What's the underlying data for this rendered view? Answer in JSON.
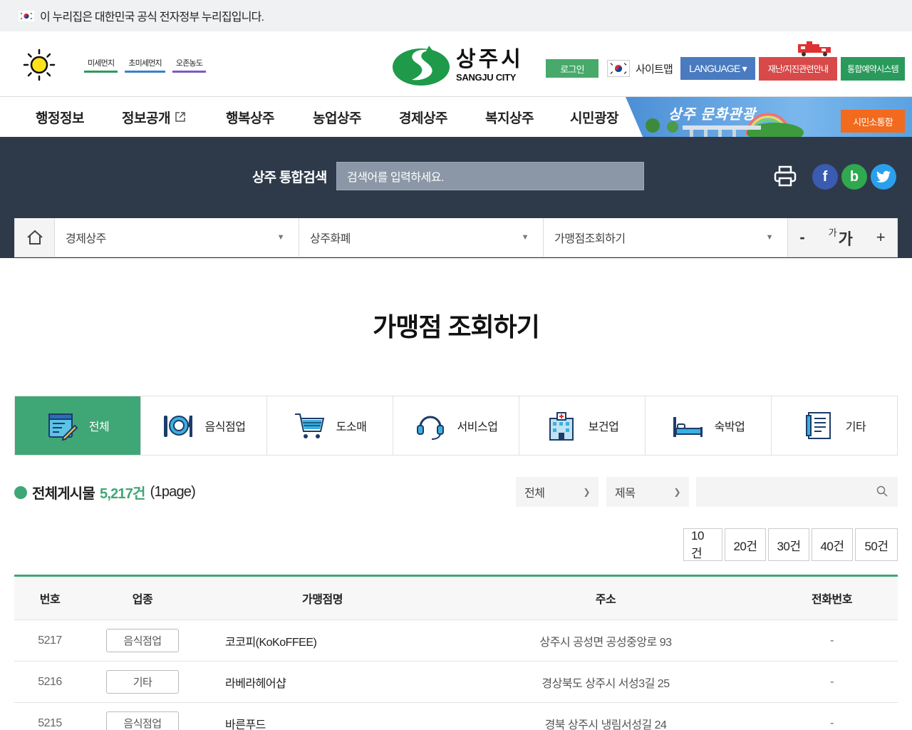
{
  "gov_notice": "이 누리집은 대한민국 공식 전자정부 누리집입니다.",
  "dust": [
    {
      "label": "미세먼지",
      "color": "#2e9a5c"
    },
    {
      "label": "초미세먼지",
      "color": "#3a7fd0"
    },
    {
      "label": "오존농도",
      "color": "#7a5bc2"
    }
  ],
  "logo": {
    "ko": "상주시",
    "en": "SANGJU CITY"
  },
  "header": {
    "login": "로그인",
    "sitemap": "사이트맵",
    "language": "LANGUAGE ▾",
    "disaster": "재난/지진관련안내",
    "reserve": "통합예약시스템"
  },
  "gnb": [
    "행정정보",
    "정보공개",
    "행복상주",
    "농업상주",
    "경제상주",
    "복지상주",
    "시민광장"
  ],
  "banner": {
    "title": "상주 문화관광",
    "button": "시민소통함"
  },
  "search": {
    "label": "상주 통합검색",
    "placeholder": "검색어를 입력하세요."
  },
  "location": [
    "경제상주",
    "상주화폐",
    "가맹점조회하기"
  ],
  "font_ctrl": {
    "minus": "-",
    "small": "가",
    "large": "가",
    "plus": "+"
  },
  "page_title": "가맹점 조회하기",
  "categories": [
    {
      "label": "전체",
      "icon": "board-write-icon"
    },
    {
      "label": "음식점업",
      "icon": "restaurant-icon"
    },
    {
      "label": "도소매",
      "icon": "cart-icon"
    },
    {
      "label": "서비스업",
      "icon": "headset-icon"
    },
    {
      "label": "보건업",
      "icon": "hospital-icon"
    },
    {
      "label": "숙박업",
      "icon": "bed-icon"
    },
    {
      "label": "기타",
      "icon": "document-icon"
    }
  ],
  "summary": {
    "prefix": "전체게시물",
    "count": "5,217건",
    "page": "(1page)"
  },
  "filters": {
    "scope": "전체",
    "field": "제목"
  },
  "per_page": [
    "10건",
    "20건",
    "30건",
    "40건",
    "50건"
  ],
  "table": {
    "headers": [
      "번호",
      "업종",
      "가맹점명",
      "주소",
      "전화번호"
    ],
    "rows": [
      {
        "no": "5217",
        "type": "음식점업",
        "name": "코코피(KoKoFFEE)",
        "addr": "상주시 공성면 공성중앙로 93",
        "tel": "-"
      },
      {
        "no": "5216",
        "type": "기타",
        "name": "라베라헤어샵",
        "addr": "경상북도 상주시 서성3길 25",
        "tel": "-"
      },
      {
        "no": "5215",
        "type": "음식점업",
        "name": "바른푸드",
        "addr": "경북 상주시 냉림서성길 24",
        "tel": "-"
      }
    ]
  }
}
